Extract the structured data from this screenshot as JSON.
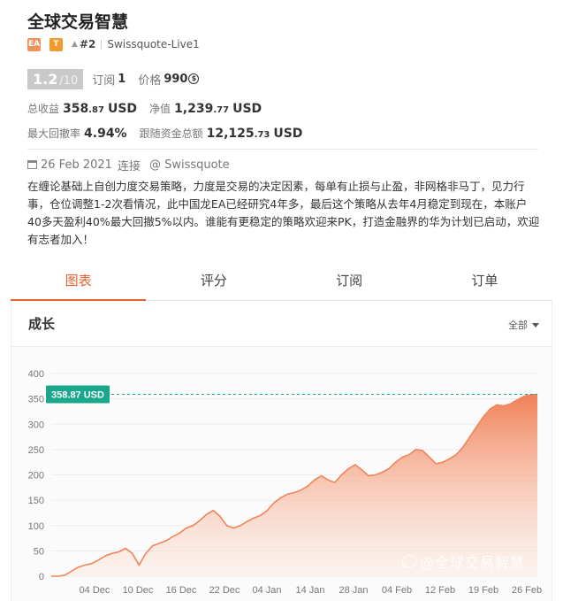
{
  "header": {
    "title": "全球交易智慧",
    "tag_ea": "EA",
    "tag_t": "T",
    "rank": "#2",
    "broker": "Swissquote-Live1"
  },
  "score": {
    "value": "1.2",
    "max": "/10",
    "subs_label": "订阅",
    "subs_value": "1",
    "price_label": "价格",
    "price_value": "990",
    "price_icon_glyph": "$"
  },
  "stats": {
    "total_profit_label": "总收益",
    "total_profit_int": "358",
    "total_profit_dec": ".87",
    "total_profit_cur": "USD",
    "equity_label": "净值",
    "equity_int": "1,239",
    "equity_dec": ".77",
    "equity_cur": "USD",
    "max_drawdown_label": "最大回撤率",
    "max_drawdown_value": "4.94%",
    "follow_funds_label": "跟随资金总额",
    "follow_funds_int": "12,125",
    "follow_funds_dec": ".73",
    "follow_funds_cur": "USD"
  },
  "connection": {
    "date": "26 Feb 2021",
    "connect_label": "连接",
    "via": "@ Swissquote"
  },
  "description": "在缠论基础上自创力度交易策略，力度是交易的决定因素，每单有止损与止盈，非网格非马丁，见力行事，仓位调整1-2次看情况，此中国龙EA已经研究4年多，最后这个策略从去年4月稳定到现在，本账户40多天盈利40%最大回撤5%以内。谁能有更稳定的策略欢迎来PK，打造金融界的华为计划已启动，欢迎有志者加入！",
  "tabs": [
    {
      "label": "图表",
      "active": true
    },
    {
      "label": "评分",
      "active": false
    },
    {
      "label": "订阅",
      "active": false
    },
    {
      "label": "订单",
      "active": false
    }
  ],
  "growth": {
    "title": "成长",
    "range": "全部"
  },
  "watermark": "@全球交易智慧",
  "colors": {
    "accent": "#e8622e",
    "line": "#f0845a",
    "marker": "#1aa88c"
  },
  "chart_data": {
    "type": "area",
    "title": "",
    "xlabel": "",
    "ylabel": "",
    "ylim": [
      0,
      400
    ],
    "yticks": [
      0,
      50,
      100,
      150,
      200,
      250,
      300,
      350,
      400
    ],
    "x_ticks": [
      "04 Dec",
      "10 Dec",
      "16 Dec",
      "22 Dec",
      "04 Jan",
      "14 Jan",
      "28 Jan",
      "04 Feb",
      "12 Feb",
      "19 Feb",
      "26 Feb"
    ],
    "current_label": "358.87 USD",
    "current_value": 358.87,
    "grid": true,
    "series": [
      {
        "values": [
          0,
          0,
          2,
          10,
          18,
          22,
          25,
          32,
          40,
          45,
          48,
          55,
          45,
          22,
          45,
          60,
          65,
          70,
          78,
          85,
          95,
          100,
          110,
          122,
          130,
          118,
          100,
          95,
          100,
          108,
          115,
          120,
          130,
          145,
          155,
          162,
          165,
          170,
          178,
          190,
          198,
          190,
          185,
          200,
          212,
          220,
          210,
          198,
          200,
          205,
          212,
          225,
          235,
          240,
          250,
          248,
          235,
          222,
          225,
          232,
          240,
          255,
          275,
          295,
          315,
          330,
          338,
          336,
          340,
          348,
          355,
          358,
          358.87
        ]
      }
    ]
  }
}
